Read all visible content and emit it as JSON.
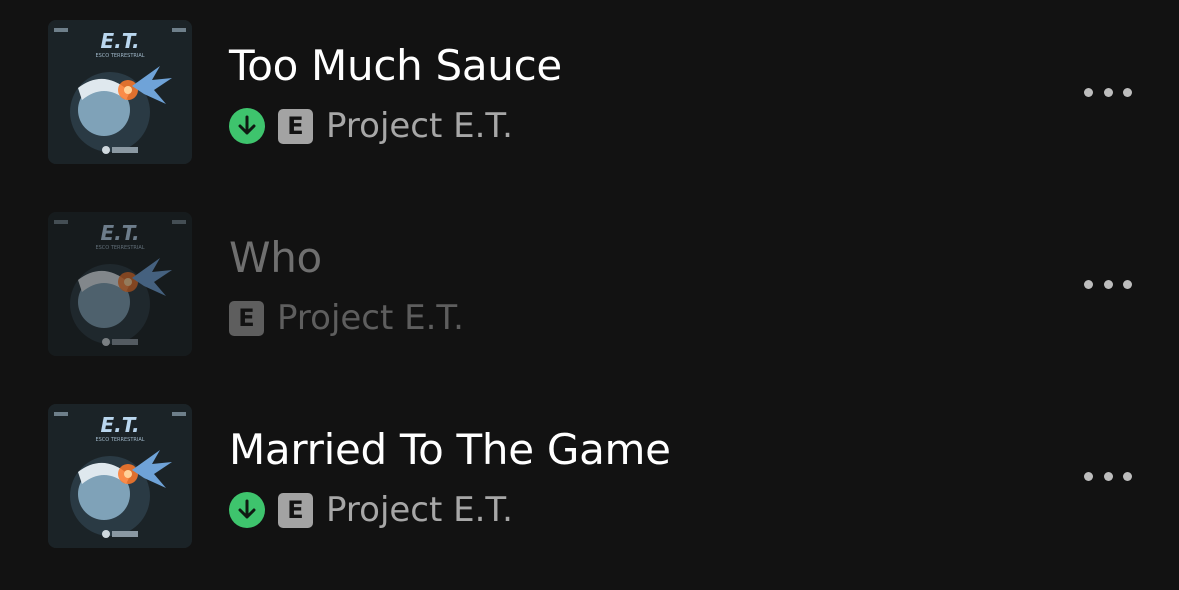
{
  "tracks": [
    {
      "title": "Too Much Sauce",
      "album": "Project E.T.",
      "explicit_label": "E",
      "downloaded": true,
      "available": true,
      "artwork_icon": "album-artwork-project-et"
    },
    {
      "title": "Who",
      "album": "Project E.T.",
      "explicit_label": "E",
      "downloaded": false,
      "available": false,
      "artwork_icon": "album-artwork-project-et"
    },
    {
      "title": "Married To The Game",
      "album": "Project E.T.",
      "explicit_label": "E",
      "downloaded": true,
      "available": true,
      "artwork_icon": "album-artwork-project-et"
    }
  ],
  "artwork_text": {
    "logo": "E.T.",
    "subtitle": "ESCO TERRESTRIAL"
  },
  "icons": {
    "download": "arrow-down-circle-icon",
    "more": "ellipsis-horizontal-icon"
  },
  "colors": {
    "background": "#121212",
    "download_green": "#3ec46d",
    "title": "#ffffff",
    "secondary": "#a7a7a7",
    "disabled_title": "#6f6f6f"
  }
}
